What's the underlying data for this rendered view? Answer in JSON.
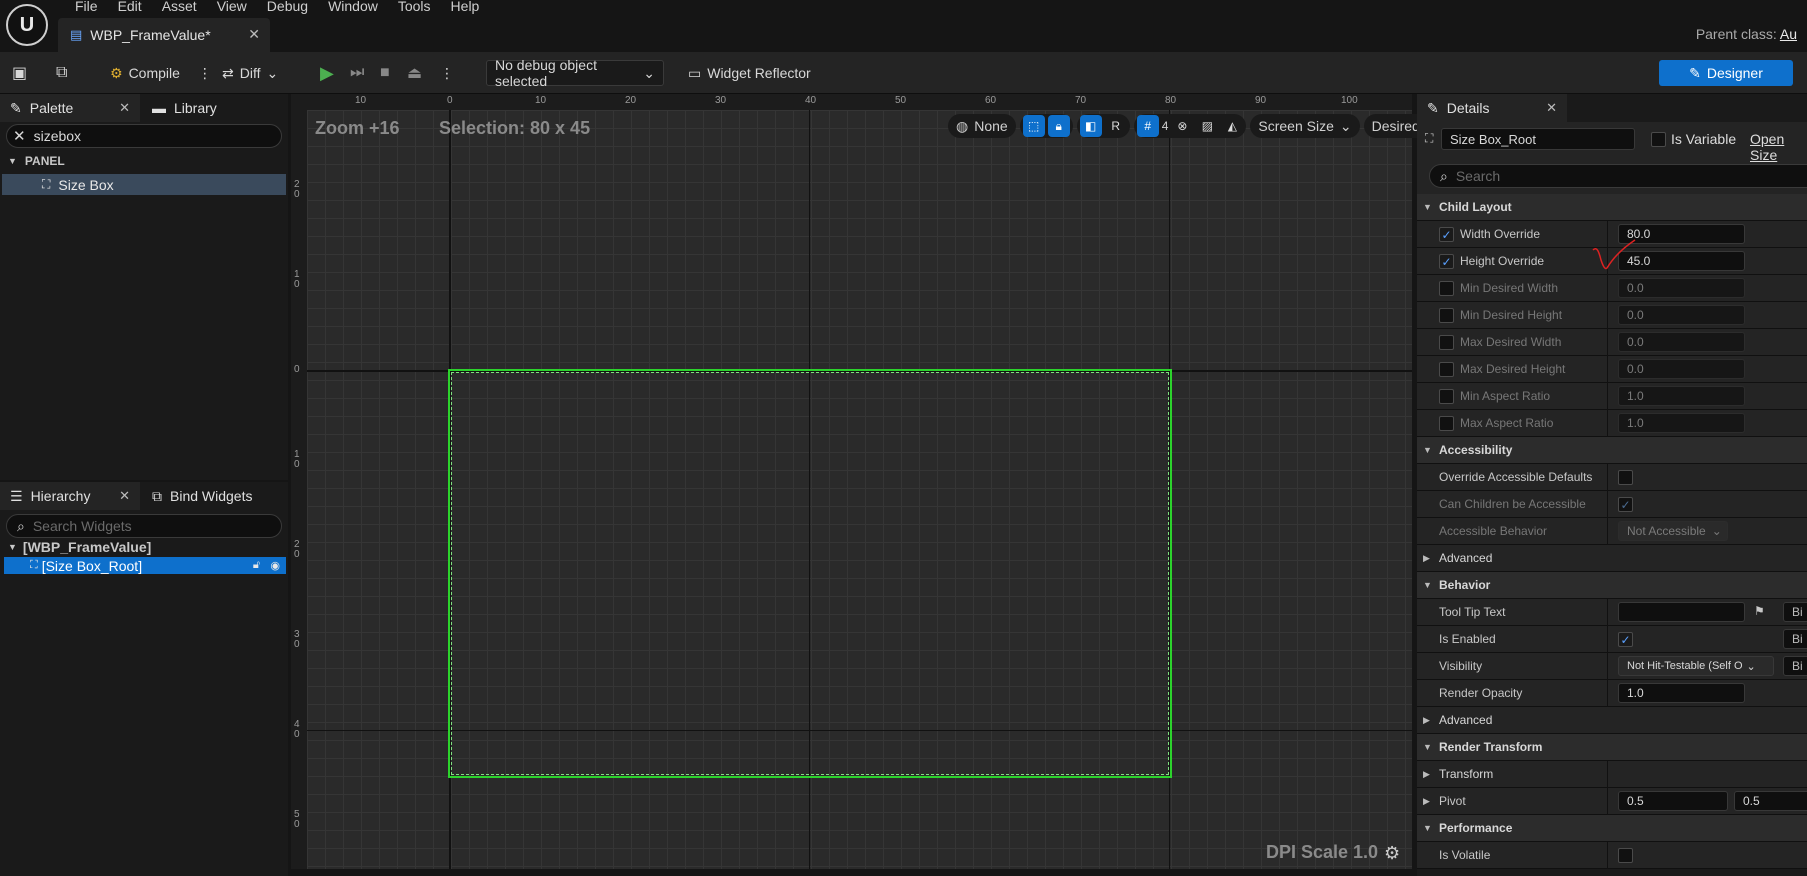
{
  "menu": [
    "File",
    "Edit",
    "Asset",
    "View",
    "Debug",
    "Window",
    "Tools",
    "Help"
  ],
  "doc_tab": {
    "title": "WBP_FrameValue*"
  },
  "parent_class": {
    "label": "Parent class:",
    "value": "Au"
  },
  "toolbar": {
    "compile": "Compile",
    "diff": "Diff",
    "debug_object": "No debug object selected",
    "widget_reflector": "Widget Reflector",
    "designer": "Designer"
  },
  "palette": {
    "tab": "Palette",
    "library_tab": "Library",
    "search_value": "sizebox",
    "category": "PANEL",
    "item": "Size Box"
  },
  "hierarchy": {
    "tab": "Hierarchy",
    "bind_tab": "Bind Widgets",
    "search_placeholder": "Search Widgets",
    "root": "[WBP_FrameValue]",
    "child": "[Size Box_Root]"
  },
  "viewport": {
    "zoom": "Zoom +16",
    "selection": "Selection: 80 x 45",
    "none": "None",
    "r": "R",
    "grid_snap": "4",
    "screen_size": "Screen Size",
    "desired": "Desired",
    "dpi": "DPI Scale 1.0",
    "ruler_top": [
      "10",
      "0",
      "10",
      "20",
      "30",
      "40",
      "50",
      "60",
      "70",
      "80",
      "90",
      "100"
    ],
    "ruler_left": [
      "2 0",
      "1 0",
      "0",
      "1 0",
      "2 0",
      "3 0",
      "4 0",
      "5 0"
    ]
  },
  "details": {
    "tab": "Details",
    "name": "Size Box_Root",
    "is_variable": "Is Variable",
    "open_size": "Open Size",
    "search_placeholder": "Search",
    "sections": {
      "child_layout": "Child Layout",
      "accessibility": "Accessibility",
      "advanced": "Advanced",
      "behavior": "Behavior",
      "advanced2": "Advanced",
      "render_transform": "Render Transform",
      "transform": "Transform",
      "performance": "Performance"
    },
    "rows": {
      "width_override": {
        "label": "Width Override",
        "value": "80.0"
      },
      "height_override": {
        "label": "Height Override",
        "value": "45.0"
      },
      "min_desired_width": {
        "label": "Min Desired Width",
        "value": "0.0"
      },
      "min_desired_height": {
        "label": "Min Desired Height",
        "value": "0.0"
      },
      "max_desired_width": {
        "label": "Max Desired Width",
        "value": "0.0"
      },
      "max_desired_height": {
        "label": "Max Desired Height",
        "value": "0.0"
      },
      "min_aspect": {
        "label": "Min Aspect Ratio",
        "value": "1.0"
      },
      "max_aspect": {
        "label": "Max Aspect Ratio",
        "value": "1.0"
      },
      "override_accessible": {
        "label": "Override Accessible Defaults"
      },
      "can_children": {
        "label": "Can Children be Accessible"
      },
      "accessible_behavior": {
        "label": "Accessible Behavior",
        "value": "Not Accessible"
      },
      "tooltip": {
        "label": "Tool Tip Text",
        "value": ""
      },
      "is_enabled": {
        "label": "Is Enabled"
      },
      "visibility": {
        "label": "Visibility",
        "value": "Not Hit-Testable (Self O"
      },
      "render_opacity": {
        "label": "Render Opacity",
        "value": "1.0"
      },
      "pivot": {
        "label": "Pivot",
        "x": "0.5",
        "y": "0.5"
      },
      "is_volatile": {
        "label": "Is Volatile"
      }
    },
    "bind": "Bi"
  }
}
